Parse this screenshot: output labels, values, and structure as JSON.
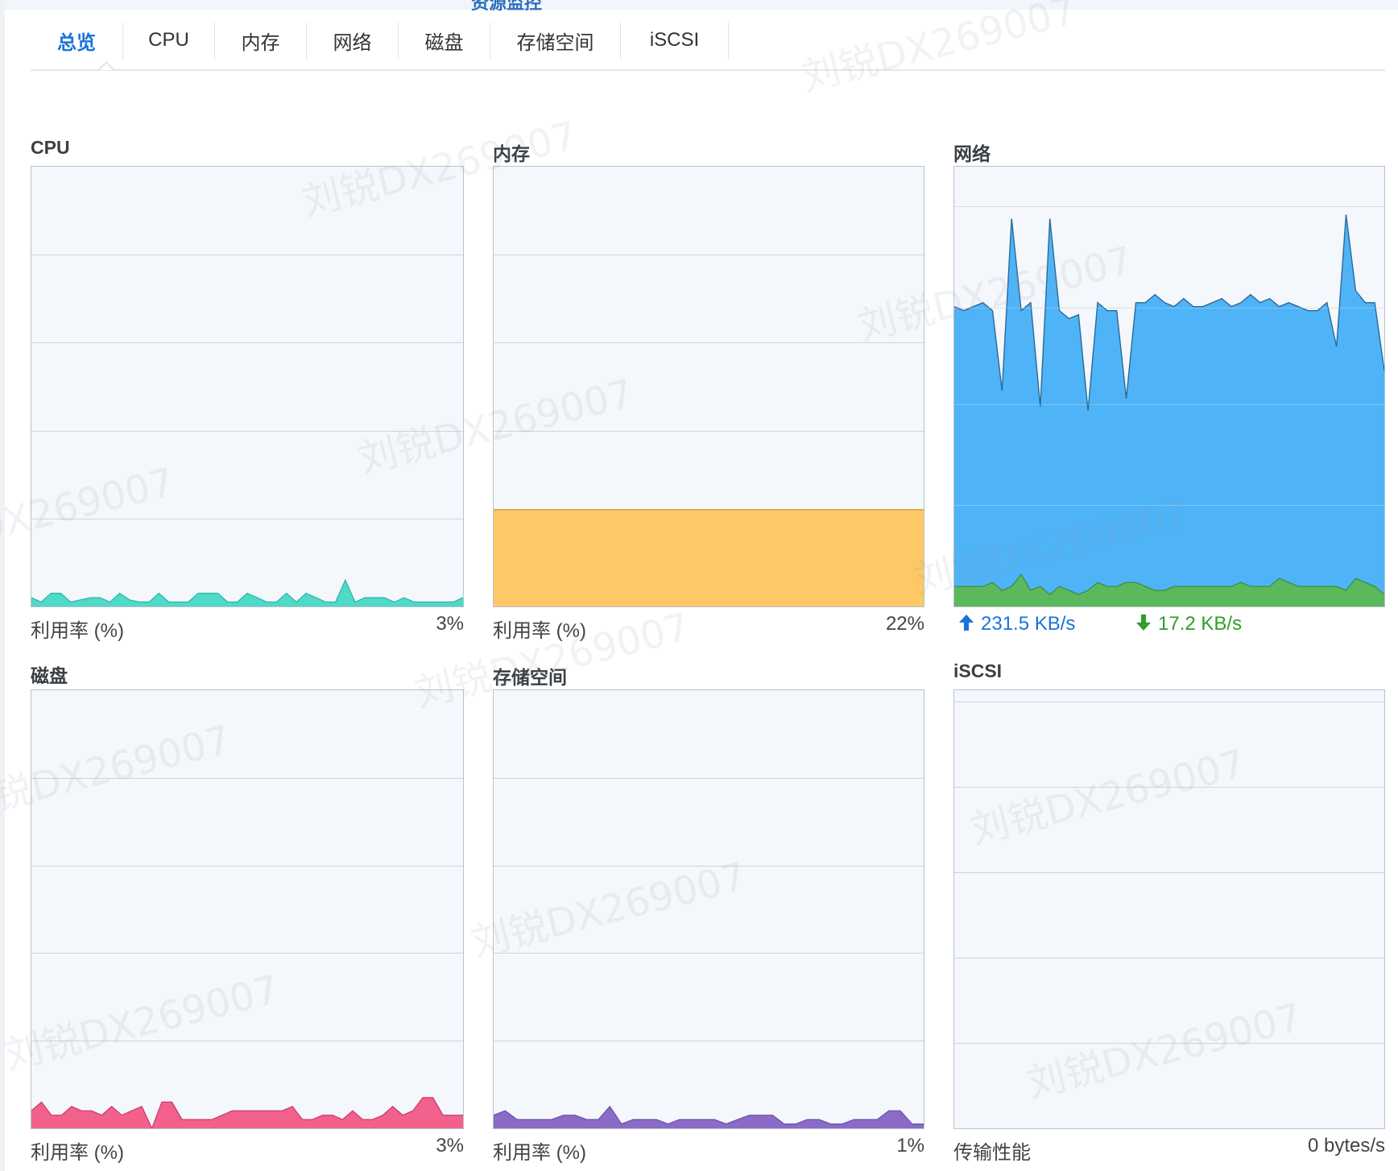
{
  "window": {
    "title": "资源监控"
  },
  "tabs": [
    {
      "label": "总览",
      "active": true
    },
    {
      "label": "CPU"
    },
    {
      "label": "内存"
    },
    {
      "label": "网络"
    },
    {
      "label": "磁盘"
    },
    {
      "label": "存储空间"
    },
    {
      "label": "iSCSI"
    }
  ],
  "panels": {
    "cpu": {
      "title": "CPU",
      "label": "利用率 (%)",
      "value": "3%",
      "color": "#4fd9c9",
      "stroke": "#2fb5a6",
      "series": [
        2,
        1,
        3,
        3,
        1,
        1.5,
        2,
        2,
        1,
        3,
        1.5,
        1,
        1,
        3,
        1,
        1,
        1,
        3,
        3,
        3,
        1,
        1,
        3,
        2,
        1,
        1,
        3,
        1,
        3,
        2,
        1,
        1,
        6,
        1,
        2,
        2,
        2,
        1,
        2,
        1,
        1,
        1,
        1,
        1,
        2
      ]
    },
    "memory": {
      "title": "内存",
      "label": "利用率 (%)",
      "value": "22%",
      "color": "#fdc865",
      "stroke": "#c6962e",
      "series": [
        22,
        22,
        22,
        22,
        22,
        22,
        22,
        22,
        22,
        22,
        22,
        22,
        22,
        22,
        22,
        22,
        22,
        22,
        22,
        22,
        22,
        22
      ]
    },
    "network": {
      "title": "网络",
      "upload": "231.5 KB/s",
      "download": "17.2 KB/s",
      "upload_color": "#4fb3f7",
      "download_color": "#5cb85c",
      "upload_series": [
        75,
        74,
        75,
        76,
        74,
        54,
        97,
        74,
        76,
        50,
        97,
        74,
        72,
        73,
        49,
        76,
        74,
        74,
        52,
        76,
        76,
        78,
        76,
        75,
        77,
        75,
        75,
        76,
        77,
        75,
        76,
        78,
        76,
        77,
        75,
        76,
        75,
        74,
        74,
        76,
        65,
        98,
        79,
        76,
        76,
        59
      ],
      "download_series": [
        5,
        5,
        5,
        5,
        6,
        4,
        5,
        8,
        4,
        5,
        3,
        5,
        4,
        3,
        4,
        6,
        5,
        5,
        6,
        6,
        5,
        4,
        4,
        5,
        5,
        5,
        5,
        5,
        5,
        5,
        6,
        5,
        5,
        5,
        7,
        6,
        5,
        5,
        5,
        5,
        5,
        4,
        7,
        6,
        5,
        3
      ]
    },
    "disk": {
      "title": "磁盘",
      "label": "利用率 (%)",
      "value": "3%",
      "color": "#f2608c",
      "stroke": "#c93b66",
      "series": [
        4,
        6,
        3,
        3,
        5,
        4,
        4,
        3,
        5,
        3,
        4,
        5,
        0,
        6,
        6,
        2,
        2,
        2,
        2,
        3,
        4,
        4,
        4,
        4,
        4,
        4,
        5,
        2,
        2,
        3,
        3,
        2,
        4,
        2,
        2,
        3,
        5,
        3,
        4,
        7,
        7,
        3,
        3,
        3
      ]
    },
    "storage": {
      "title": "存储空间",
      "label": "利用率 (%)",
      "value": "1%",
      "color": "#8a6bc7",
      "stroke": "#6a4fa8",
      "series": [
        3,
        4,
        2,
        2,
        2,
        2,
        3,
        3,
        2,
        2,
        5,
        1,
        2,
        2,
        2,
        1,
        2,
        2,
        2,
        2,
        1,
        2,
        3,
        3,
        3,
        1,
        1,
        2,
        2,
        1,
        1,
        2,
        2,
        2,
        4,
        4,
        1,
        1
      ]
    },
    "iscsi": {
      "title": "iSCSI",
      "label": "传输性能",
      "value": "0 bytes/s"
    }
  },
  "watermark": "刘锐DX269007"
}
